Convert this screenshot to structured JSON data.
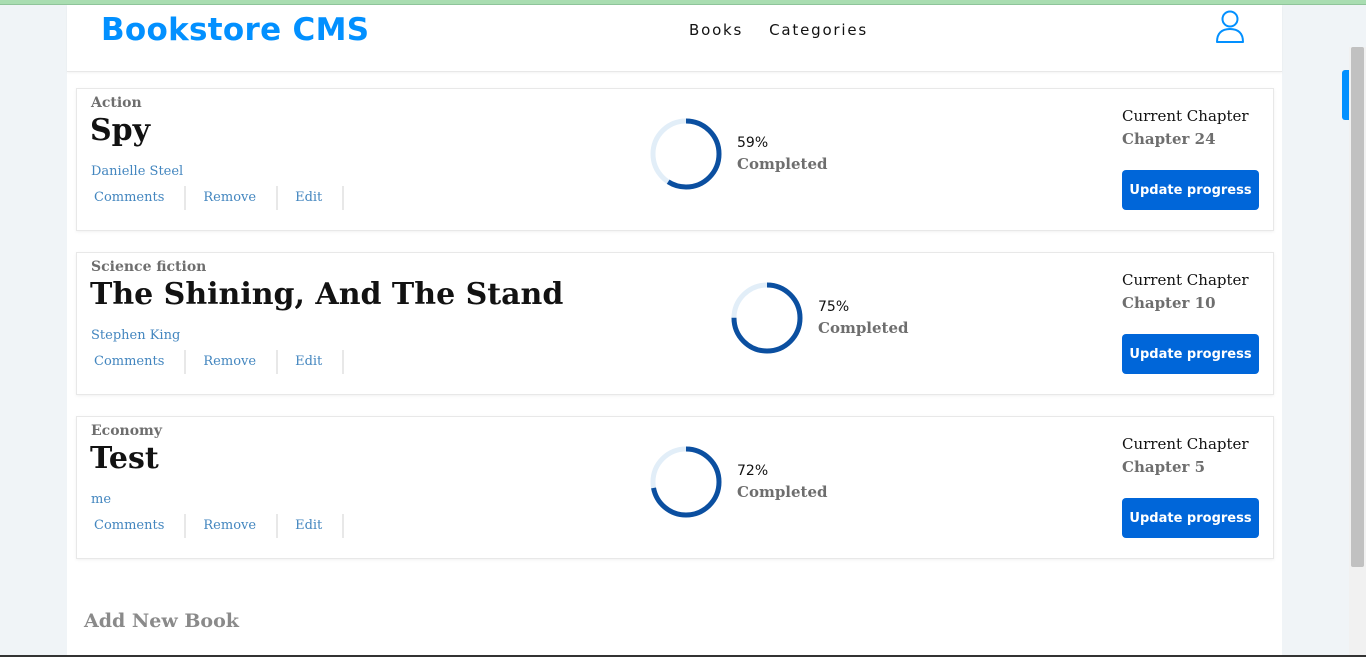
{
  "header": {
    "brand": "Bookstore CMS",
    "nav": [
      "Books",
      "Categories"
    ]
  },
  "actions": {
    "comments": "Comments",
    "remove": "Remove",
    "edit": "Edit"
  },
  "labels": {
    "completed": "Completed",
    "current_chapter": "Current Chapter",
    "update_progress": "Update progress"
  },
  "books": [
    {
      "genre": "Action",
      "title": "Spy",
      "author": "Danielle Steel",
      "percent": 59,
      "percent_label": "59%",
      "chapter": "Chapter 24"
    },
    {
      "genre": "Science fiction",
      "title": "The Shining, And The Stand",
      "author": "Stephen King",
      "percent": 75,
      "percent_label": "75%",
      "chapter": "Chapter 10"
    },
    {
      "genre": "Economy",
      "title": "Test",
      "author": "me",
      "percent": 72,
      "percent_label": "72%",
      "chapter": "Chapter 5"
    }
  ],
  "add_book": {
    "title": "Add New Book"
  },
  "colors": {
    "brand": "#0290ff",
    "button": "#0066d9",
    "progress_ring": "#0b4fa0",
    "progress_track": "#e2eef8"
  }
}
